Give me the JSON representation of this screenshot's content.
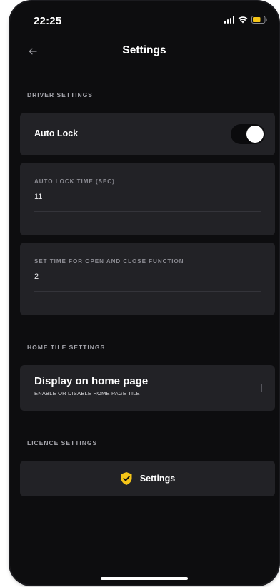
{
  "status_bar": {
    "time": "22:25",
    "icons": [
      "signal-icon",
      "wifi-icon",
      "battery-icon"
    ]
  },
  "header": {
    "title": "Settings",
    "back_icon": "arrow-left-icon"
  },
  "driver_settings": {
    "section_label": "DRIVER SETTINGS",
    "auto_lock": {
      "label": "Auto Lock",
      "enabled": true
    },
    "auto_lock_time": {
      "label": "AUTO LOCK TIME (SEC)",
      "value": "11"
    },
    "open_close_time": {
      "label": "SET TIME FOR OPEN AND CLOSE FUNCTION",
      "value": "2"
    }
  },
  "home_tile_settings": {
    "section_label": "HOME TILE SETTINGS",
    "title": "Display on home page",
    "subtitle": "ENABLE OR DISABLE HOME PAGE TILE",
    "checked": false
  },
  "licence_settings": {
    "section_label": "LICENCE SETTINGS",
    "button_label": "Settings",
    "icon": "shield-check-icon"
  },
  "colors": {
    "background": "#0d0d0f",
    "card": "#222226",
    "accent": "#f5c518",
    "muted_text": "#a6a6ad"
  }
}
